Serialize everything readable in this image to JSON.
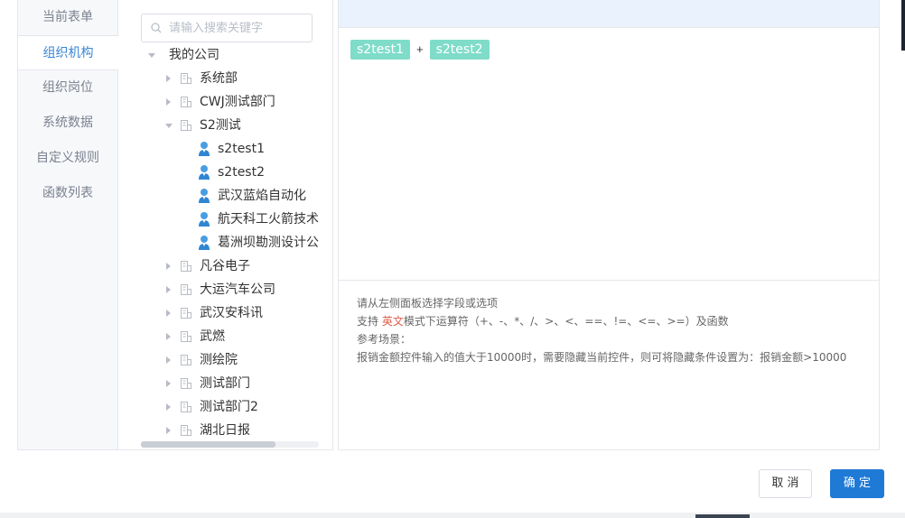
{
  "tabs": [
    {
      "label": "当前表单",
      "active": false
    },
    {
      "label": "组织机构",
      "active": true
    },
    {
      "label": "组织岗位",
      "active": false
    },
    {
      "label": "系统数据",
      "active": false
    },
    {
      "label": "自定义规则",
      "active": false
    },
    {
      "label": "函数列表",
      "active": false
    }
  ],
  "search": {
    "placeholder": "请输入搜索关键字",
    "value": ""
  },
  "tree": {
    "root": "我的公司",
    "items": [
      {
        "label": "系统部",
        "type": "org",
        "expanded": false
      },
      {
        "label": "CWJ测试部门",
        "type": "org",
        "expanded": false
      },
      {
        "label": "S2测试",
        "type": "org",
        "expanded": true
      },
      {
        "label": "s2test1",
        "type": "user"
      },
      {
        "label": "s2test2",
        "type": "user"
      },
      {
        "label": "武汉蓝焰自动化",
        "type": "user"
      },
      {
        "label": "航天科工火箭技术",
        "type": "user"
      },
      {
        "label": "葛洲坝勘测设计公",
        "type": "user"
      },
      {
        "label": "凡谷电子",
        "type": "org",
        "expanded": false
      },
      {
        "label": "大运汽车公司",
        "type": "org",
        "expanded": false
      },
      {
        "label": "武汉安科讯",
        "type": "org",
        "expanded": false
      },
      {
        "label": "武燃",
        "type": "org",
        "expanded": false
      },
      {
        "label": "测绘院",
        "type": "org",
        "expanded": false
      },
      {
        "label": "测试部门",
        "type": "org",
        "expanded": false
      },
      {
        "label": "测试部门2",
        "type": "org",
        "expanded": false
      },
      {
        "label": "湖北日报",
        "type": "org",
        "expanded": false
      }
    ]
  },
  "formula": {
    "left": "s2test1",
    "operator": "+",
    "right": "s2test2"
  },
  "help": {
    "line1": "请从左侧面板选择字段或选项",
    "line2_prefix": "支持 ",
    "line2_highlight": "英文",
    "line2_suffix": "模式下运算符（+、-、*、/、>、<、==、!=、<=、>=）及函数",
    "line3": "参考场景：",
    "line4": "报销金额控件输入的值大于10000时，需要隐藏当前控件，则可将隐藏条件设置为：报销金额>10000"
  },
  "buttons": {
    "cancel": "取 消",
    "ok": "确 定"
  },
  "colors": {
    "accent": "#1f7ad6",
    "tag": "#7fdcc9",
    "highlight": "#e15b4b"
  }
}
